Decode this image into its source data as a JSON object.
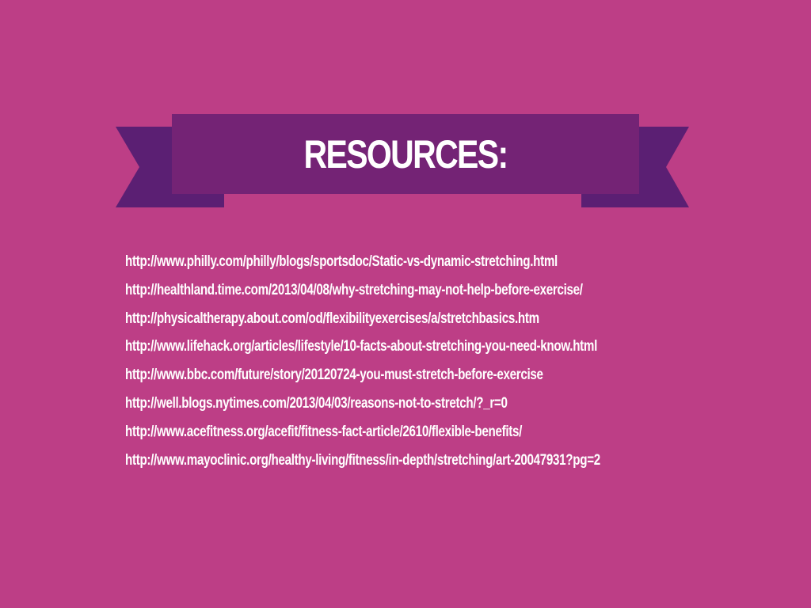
{
  "slide": {
    "title": "RESOURCES:",
    "colors": {
      "background": "#bd3e86",
      "banner_front": "#742375",
      "banner_tails": "#5b1f73",
      "text": "#ffffff"
    },
    "links": [
      "http://www.philly.com/philly/blogs/sportsdoc/Static-vs-dynamic-stretching.html",
      "http://healthland.time.com/2013/04/08/why-stretching-may-not-help-before-exercise/",
      "http://physicaltherapy.about.com/od/flexibilityexercises/a/stretchbasics.htm",
      "http://www.lifehack.org/articles/lifestyle/10-facts-about-stretching-you-need-know.html",
      "http://www.bbc.com/future/story/20120724-you-must-stretch-before-exercise",
      "http://well.blogs.nytimes.com/2013/04/03/reasons-not-to-stretch/?_r=0",
      "http://www.acefitness.org/acefit/fitness-fact-article/2610/flexible-benefits/",
      "http://www.mayoclinic.org/healthy-living/fitness/in-depth/stretching/art-20047931?pg=2"
    ]
  }
}
